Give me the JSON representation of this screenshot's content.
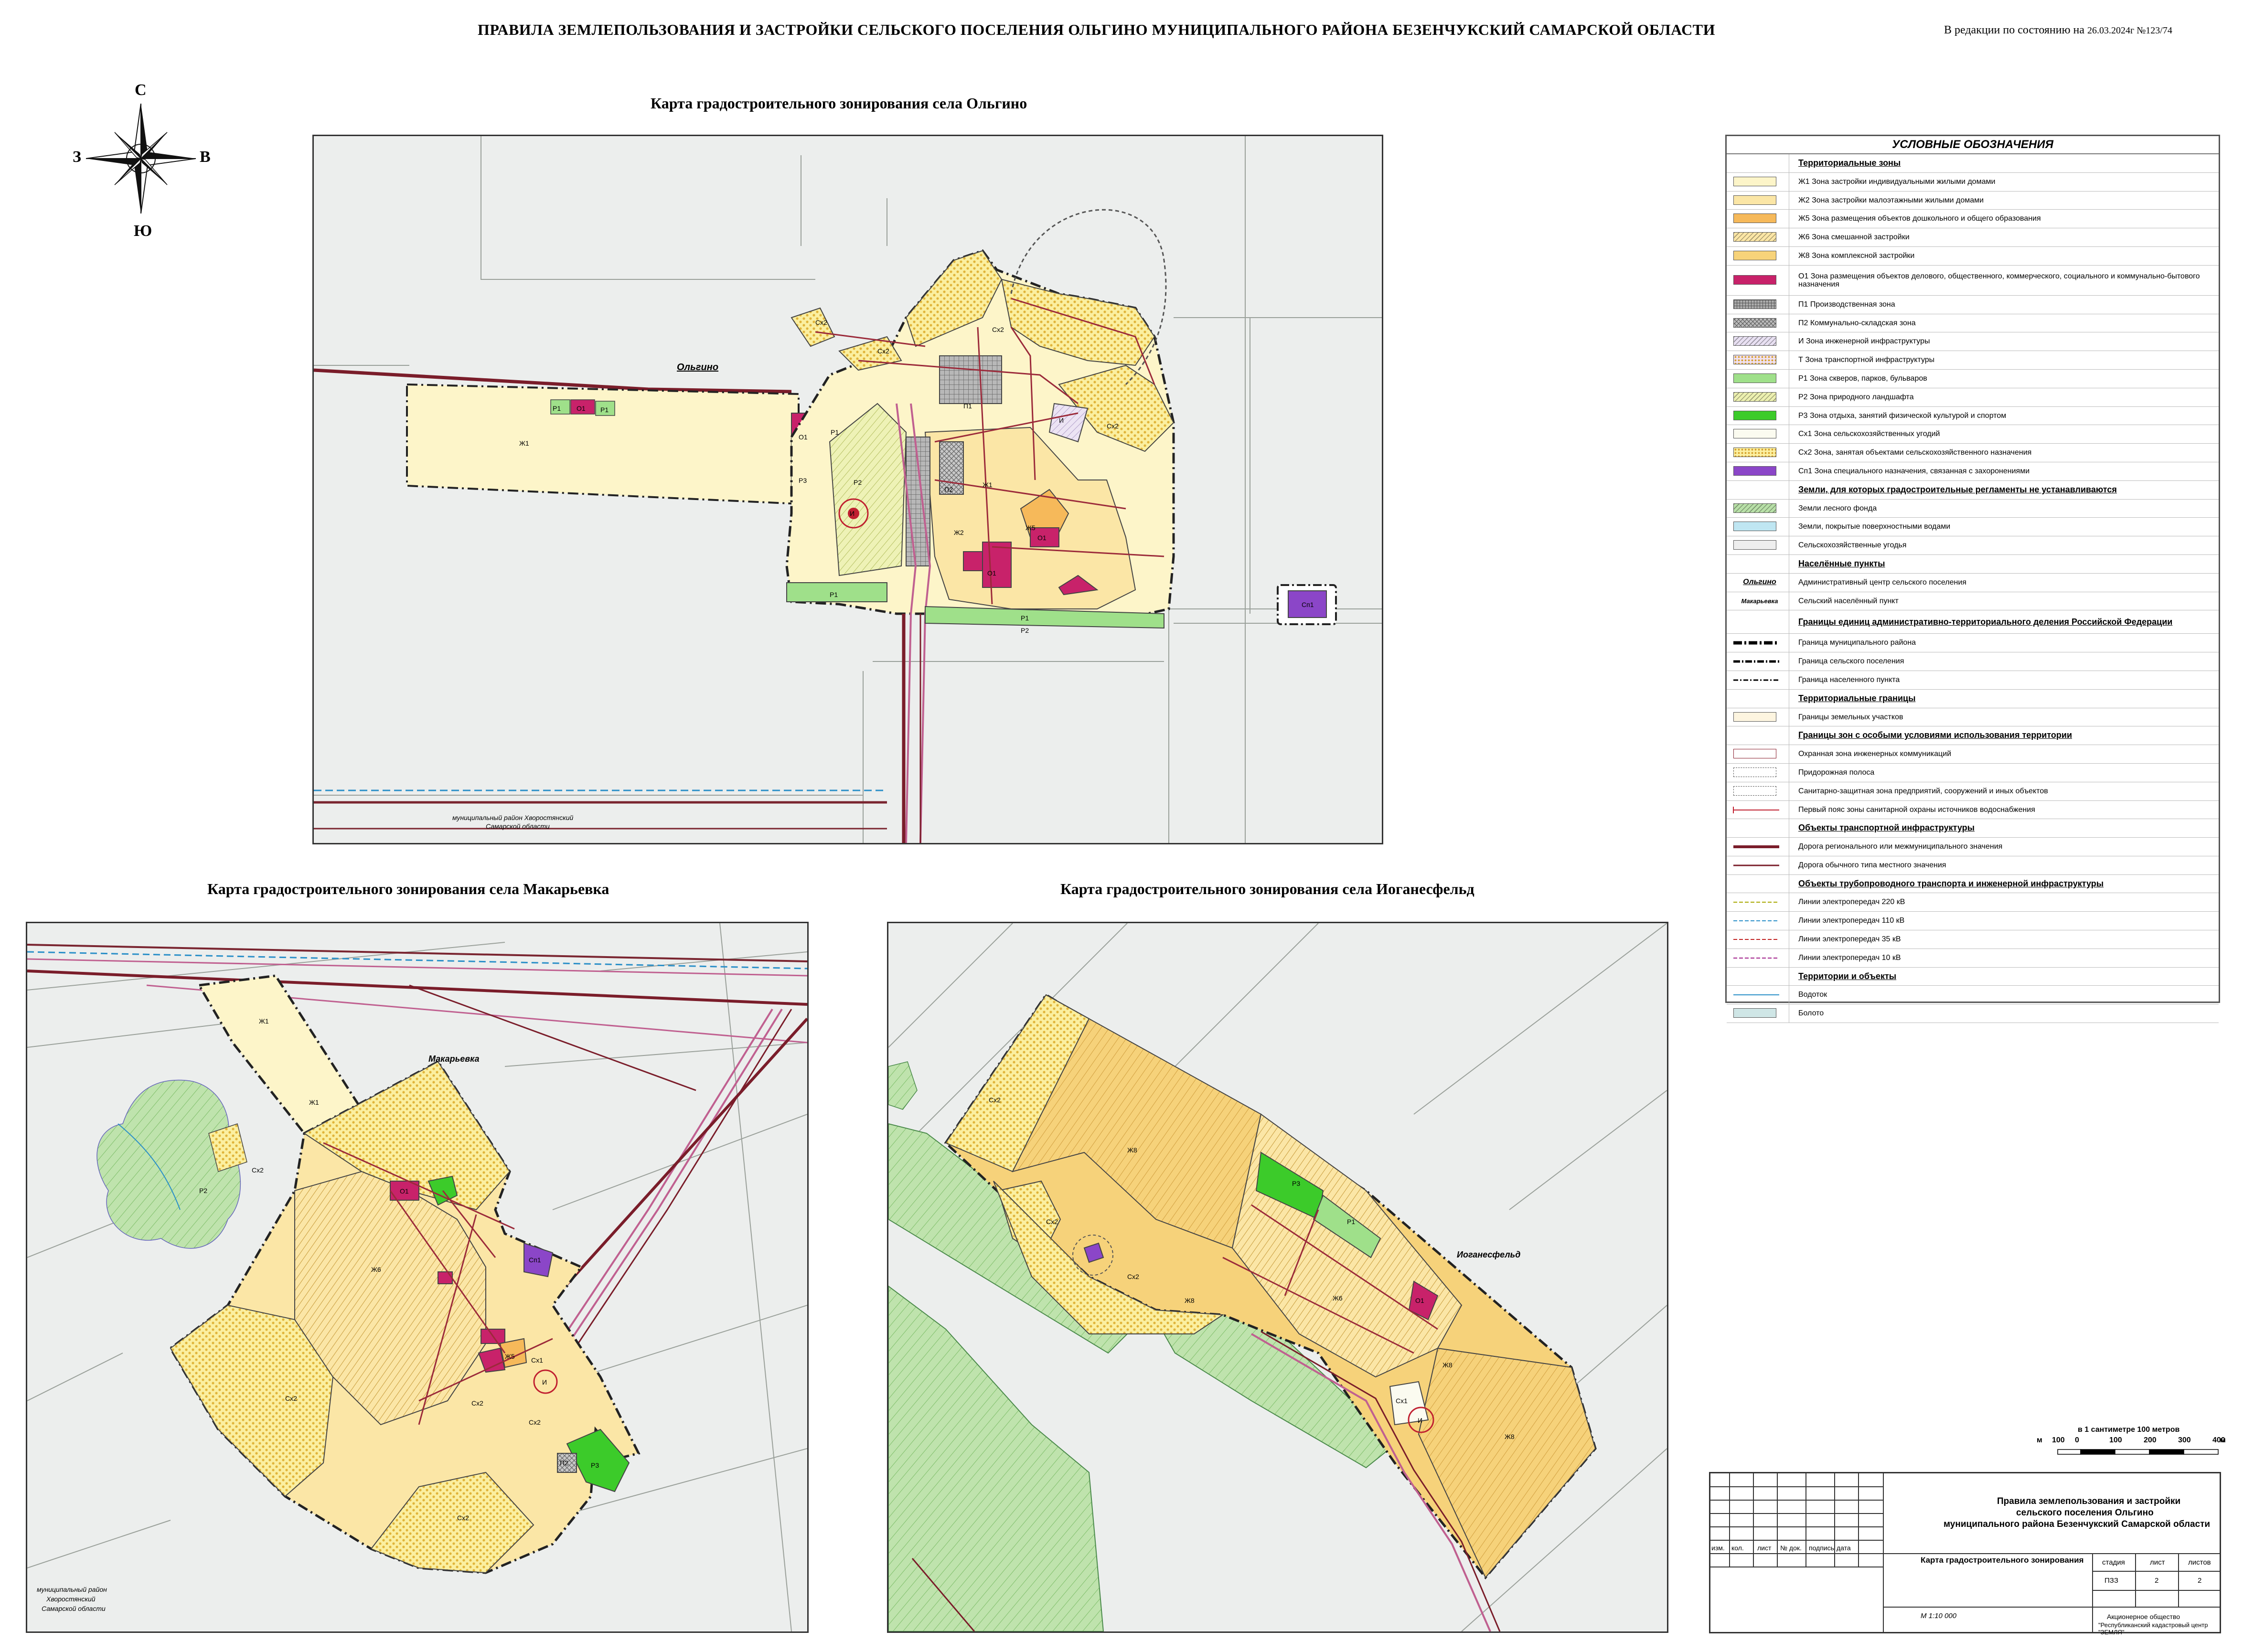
{
  "header": {
    "title": "ПРАВИЛА ЗЕМЛЕПОЛЬЗОВАНИЯ И ЗАСТРОЙКИ СЕЛЬСКОГО ПОСЕЛЕНИЯ ОЛЬГИНО МУНИЦИПАЛЬНОГО РАЙОНА БЕЗЕНЧУКСКИЙ САМАРСКОЙ ОБЛАСТИ",
    "edition_prefix": "В редакции по состоянию на ",
    "edition_value": "26.03.2024г №123/74"
  },
  "compass": {
    "n": "С",
    "s": "Ю",
    "w": "З",
    "e": "В"
  },
  "maps": {
    "olgino": {
      "title": "Карта градостроительного зонирования села Ольгино",
      "settlement": "Ольгино",
      "district_note_1": "муниципальный район Хворостянский",
      "district_note_2": "Самарской области"
    },
    "makarevka": {
      "title": "Карта градостроительного зонирования села Макарьевка",
      "settlement": "Макарьевка",
      "district_note_1": "муниципальный район",
      "district_note_2": "Хворостянский",
      "district_note_3": "Самарской области"
    },
    "iogan": {
      "title": "Карта градостроительного зонирования села Иоганесфельд",
      "settlement": "Иоганесфельд"
    }
  },
  "zone_labels": {
    "zh1": "Ж1",
    "zh2": "Ж2",
    "zh5": "Ж5",
    "zh6": "Ж6",
    "zh8": "Ж8",
    "o1": "О1",
    "p1": "П1",
    "p2": "П2",
    "i": "И",
    "r1": "Р1",
    "r2": "Р2",
    "r3": "Р3",
    "sh1": "Сх1",
    "sh2": "Сх2",
    "sp1": "Сп1"
  },
  "legend": {
    "title": "УСЛОВНЫЕ ОБОЗНАЧЕНИЯ",
    "rows": [
      {
        "type": "section",
        "text": "Территориальные зоны"
      },
      {
        "type": "fill",
        "text": "Ж1 Зона застройки индивидуальными жилыми домами",
        "color": "#fdf5c9",
        "pattern": "none"
      },
      {
        "type": "fill",
        "text": "Ж2 Зона застройки малоэтажными жилыми домами",
        "color": "#fbe6a6",
        "pattern": "none"
      },
      {
        "type": "fill",
        "text": "Ж5 Зона размещения объектов дошкольного и общего образования",
        "color": "#f6b95a",
        "pattern": "none"
      },
      {
        "type": "fill",
        "text": "Ж6 Зона смешанной застройки",
        "color": "#fbe6a6",
        "pattern": "hatch"
      },
      {
        "type": "fill",
        "text": "Ж8 Зона комплексной застройки",
        "color": "#f7d37a",
        "pattern": "none"
      },
      {
        "type": "fill",
        "text": "О1  Зона размещения объектов делового, общественного, коммерческого, социального и коммунально-бытового назначения",
        "color": "#c8226a",
        "pattern": "none",
        "size": "tall"
      },
      {
        "type": "fill",
        "text": "П1 Производственная зона",
        "color": "#aaaaaa",
        "pattern": "grid"
      },
      {
        "type": "fill",
        "text": "П2 Коммунально-складская зона",
        "color": "#bbbbbb",
        "pattern": "cross"
      },
      {
        "type": "fill",
        "text": "И Зона инженерной инфраструктуры",
        "color": "#e8e0f2",
        "pattern": "hatch"
      },
      {
        "type": "fill",
        "text": "Т Зона транспортной инфраструктуры",
        "color": "#f0e0f0",
        "pattern": "dots"
      },
      {
        "type": "fill",
        "text": "Р1 Зона скверов, парков, бульваров",
        "color": "#9fe08a",
        "pattern": "none"
      },
      {
        "type": "fill",
        "text": "Р2 Зона природного ландшафта",
        "color": "#ecf0b0",
        "pattern": "hatch"
      },
      {
        "type": "fill",
        "text": "Р3 Зона отдыха, занятий физической культурой и спортом",
        "color": "#3ccb2a",
        "pattern": "none"
      },
      {
        "type": "fill",
        "text": "Сх1 Зона сельскохозяйственных угодий",
        "color": "#fbfbf0",
        "pattern": "none"
      },
      {
        "type": "fill",
        "text": "Сх2 Зона, занятая объектами сельскохозяйственного назначения",
        "color": "#fbefa0",
        "pattern": "dots"
      },
      {
        "type": "fill",
        "text": "Сп1 Зона специального назначения, связанная с захоронениями",
        "color": "#8b46c8",
        "pattern": "none"
      },
      {
        "type": "section",
        "text": "Земли, для которых градостроительные регламенты не устанавливаются"
      },
      {
        "type": "fill",
        "text": "Земли лесного фонда",
        "color": "#b8e0a8",
        "pattern": "hatch"
      },
      {
        "type": "fill",
        "text": "Земли, покрытые поверхностными водами",
        "color": "#bfe6f2",
        "pattern": "none"
      },
      {
        "type": "fill",
        "text": "Сельскохозяйственные угодья",
        "color": "#eeeeee",
        "pattern": "none"
      },
      {
        "type": "section",
        "text": "Населённые пункты"
      },
      {
        "type": "label",
        "text": "Административный центр сельского поселения",
        "label": "Ольгино",
        "underline": true
      },
      {
        "type": "label",
        "text": "Сельский населённый пункт",
        "label": "Макарьевка",
        "underline": false
      },
      {
        "type": "section",
        "text": "Границы единиц административно-территориального деления Российской Федерации",
        "size": "mid"
      },
      {
        "type": "line",
        "text": "Граница муниципального района",
        "style": "thickdash"
      },
      {
        "type": "line",
        "text": "Граница сельского поселения",
        "style": "dashdot"
      },
      {
        "type": "line",
        "text": "Граница населенного пункта",
        "style": "dashdot2"
      },
      {
        "type": "section",
        "text": "Территориальные границы"
      },
      {
        "type": "fill",
        "text": "Границы земельных участков",
        "color": "#fdf5e0",
        "pattern": "none"
      },
      {
        "type": "section",
        "text": "Границы зон с особыми условиями использования территории"
      },
      {
        "type": "fill",
        "text": "Охранная зона инженерных коммуникаций",
        "color": "#ffffff",
        "pattern": "none",
        "border": "#8a2030"
      },
      {
        "type": "fill",
        "text": "Придорожная полоса",
        "color": "#ffffff",
        "pattern": "none",
        "border": "#555555",
        "dashed": true
      },
      {
        "type": "fill",
        "text": "Санитарно-защитная зона предприятий, сооружений и иных объектов",
        "color": "#ffffff",
        "pattern": "none",
        "border": "#555555",
        "dashed": true
      },
      {
        "type": "line",
        "text": "Первый пояс зоны санитарной охраны источников водоснабжения",
        "style": "redpoly"
      },
      {
        "type": "section",
        "text": "Объекты транспортной инфраструктуры"
      },
      {
        "type": "line",
        "text": "Дорога регионального или межмуниципального значения",
        "style": "road_reg"
      },
      {
        "type": "line",
        "text": "Дорога обычного типа местного значения",
        "style": "road_loc"
      },
      {
        "type": "section",
        "text": "Объекты трубопроводного транспорта и инженерной инфраструктуры"
      },
      {
        "type": "line",
        "text": "Линии электропередач 220 кВ",
        "style": "el220"
      },
      {
        "type": "line",
        "text": "Линии электропередач 110 кВ",
        "style": "el110"
      },
      {
        "type": "line",
        "text": "Линии электропередач 35 кВ",
        "style": "el35"
      },
      {
        "type": "line",
        "text": "Линии электропередач 10 кВ",
        "style": "el10"
      },
      {
        "type": "section",
        "text": "Территории и объекты"
      },
      {
        "type": "line",
        "text": "Водоток",
        "style": "water"
      },
      {
        "type": "fill",
        "text": "Болото",
        "color": "#cfe6e6",
        "pattern": "none"
      }
    ]
  },
  "scale": {
    "caption": "в 1 сантиметре 100 метров",
    "unit": "м",
    "ticks": [
      "100",
      "0",
      "100",
      "200",
      "300",
      "400"
    ],
    "unit_end": "м"
  },
  "stamp": {
    "project_title_1": "Правила землепользования и застройки",
    "project_title_2": "сельского поселения Ольгино",
    "project_title_3": "муниципального района Безенчукский Самарской области",
    "headers": [
      "изм.",
      "кол.",
      "лист",
      "№ док.",
      "подпись",
      "дата"
    ],
    "sheet_name": "Карта градостроительного зонирования",
    "col_stage": "стадия",
    "col_sheet": "лист",
    "col_sheets": "листов",
    "stage": "ПЗЗ",
    "sheet": "2",
    "sheets": "2",
    "scale_text": "М 1:10 000",
    "org_1": "Акционерное общество",
    "org_2": "\"Республиканский кадастровый центр \"ЗЕМЛЯ\""
  }
}
